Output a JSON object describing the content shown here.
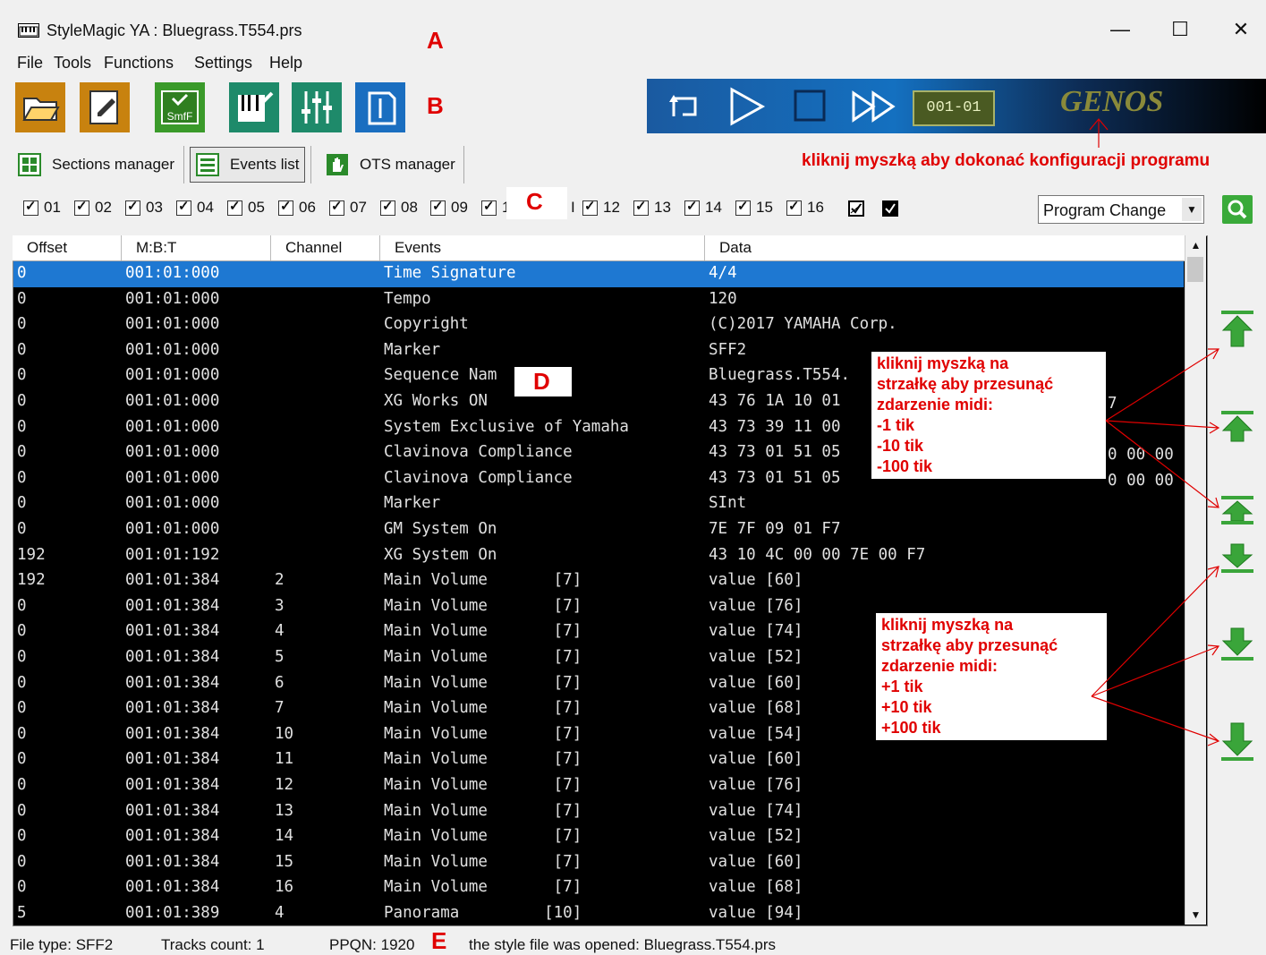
{
  "window": {
    "title": "StyleMagic YA : Bluegrass.T554.prs",
    "controls": {
      "minimize": "—",
      "maximize": "☐",
      "close": "✕"
    }
  },
  "menu": [
    "File",
    "Tools",
    "Functions",
    "Settings",
    "Help"
  ],
  "toolbar": {
    "buttons": [
      "open-icon",
      "save-icon",
      "smf-icon",
      "piano-icon",
      "mixer-icon",
      "document-icon"
    ],
    "smf_text": "SmfF"
  },
  "transport": {
    "counter": "001-01",
    "brand": "GENOS"
  },
  "tabs": [
    {
      "label": "Sections manager"
    },
    {
      "label": "Events list"
    },
    {
      "label": "OTS manager"
    }
  ],
  "channels": [
    "01",
    "02",
    "03",
    "04",
    "05",
    "06",
    "07",
    "08",
    "09",
    "1",
    "I",
    "12",
    "13",
    "14",
    "15",
    "16"
  ],
  "filter": {
    "selected": "Program Change"
  },
  "columns": [
    "Offset",
    "M:B:T",
    "Channel",
    "Events",
    "Data"
  ],
  "rows": [
    [
      "0",
      "001:01:000",
      "",
      "Time Signature",
      "4/4"
    ],
    [
      "0",
      "001:01:000",
      "",
      "Tempo",
      "120"
    ],
    [
      "0",
      "001:01:000",
      "",
      "Copyright",
      "(C)2017 YAMAHA Corp."
    ],
    [
      "0",
      "001:01:000",
      "",
      "Marker",
      "SFF2"
    ],
    [
      "0",
      "001:01:000",
      "",
      "Sequence Nam",
      "Bluegrass.T554."
    ],
    [
      "0",
      "001:01:000",
      "",
      "XG Works ON",
      "43 76 1A 10 01"
    ],
    [
      "0",
      "001:01:000",
      "",
      "System Exclusive of Yamaha",
      "43 73 39 11 00"
    ],
    [
      "0",
      "001:01:000",
      "",
      "Clavinova Compliance",
      "43 73 01 51 05"
    ],
    [
      "0",
      "001:01:000",
      "",
      "Clavinova Compliance",
      "43 73 01 51 05"
    ],
    [
      "0",
      "001:01:000",
      "",
      "Marker",
      "SInt"
    ],
    [
      "0",
      "001:01:000",
      "",
      "GM System On",
      "7E 7F 09 01 F7"
    ],
    [
      "192",
      "001:01:192",
      "",
      "XG System On",
      "43 10 4C 00 00 7E 00 F7"
    ],
    [
      "192",
      "001:01:384",
      "2",
      "Main Volume       [7]",
      "value [60]"
    ],
    [
      "0",
      "001:01:384",
      "3",
      "Main Volume       [7]",
      "value [76]"
    ],
    [
      "0",
      "001:01:384",
      "4",
      "Main Volume       [7]",
      "value [74]"
    ],
    [
      "0",
      "001:01:384",
      "5",
      "Main Volume       [7]",
      "value [52]"
    ],
    [
      "0",
      "001:01:384",
      "6",
      "Main Volume       [7]",
      "value [60]"
    ],
    [
      "0",
      "001:01:384",
      "7",
      "Main Volume       [7]",
      "value [68]"
    ],
    [
      "0",
      "001:01:384",
      "10",
      "Main Volume       [7]",
      "value [54]"
    ],
    [
      "0",
      "001:01:384",
      "11",
      "Main Volume       [7]",
      "value [60]"
    ],
    [
      "0",
      "001:01:384",
      "12",
      "Main Volume       [7]",
      "value [76]"
    ],
    [
      "0",
      "001:01:384",
      "13",
      "Main Volume       [7]",
      "value [74]"
    ],
    [
      "0",
      "001:01:384",
      "14",
      "Main Volume       [7]",
      "value [52]"
    ],
    [
      "0",
      "001:01:384",
      "15",
      "Main Volume       [7]",
      "value [60]"
    ],
    [
      "0",
      "001:01:384",
      "16",
      "Main Volume       [7]",
      "value [68]"
    ],
    [
      "5",
      "001:01:389",
      "4",
      "Panorama         [10]",
      "value [94]"
    ]
  ],
  "row_fragments": {
    "r5": "7",
    "r7": "0 00 00",
    "r8": "0 00 00"
  },
  "annotations": {
    "A": "A",
    "B": "B",
    "C": "C",
    "D": "D",
    "E": "E",
    "config_hint": "kliknij myszką aby dokonać konfiguracji programu",
    "up_box": [
      "kliknij myszką na",
      "strzałkę aby przesunąć",
      "zdarzenie midi:",
      "-1 tik",
      "-10 tik",
      "-100 tik"
    ],
    "down_box": [
      "kliknij myszką na",
      "strzałkę aby przesunąć",
      "zdarzenie midi:",
      "+1 tik",
      "+10 tik",
      "+100 tik"
    ]
  },
  "status": {
    "file_type": "File type: SFF2",
    "tracks": "Tracks count: 1",
    "ppqn": "PPQN: 1920",
    "message": "the style file was opened: Bluegrass.T554.prs"
  },
  "colors": {
    "selection": "#1e78d2",
    "annotation": "#e00000",
    "arrow_green": "#3aa53a"
  }
}
